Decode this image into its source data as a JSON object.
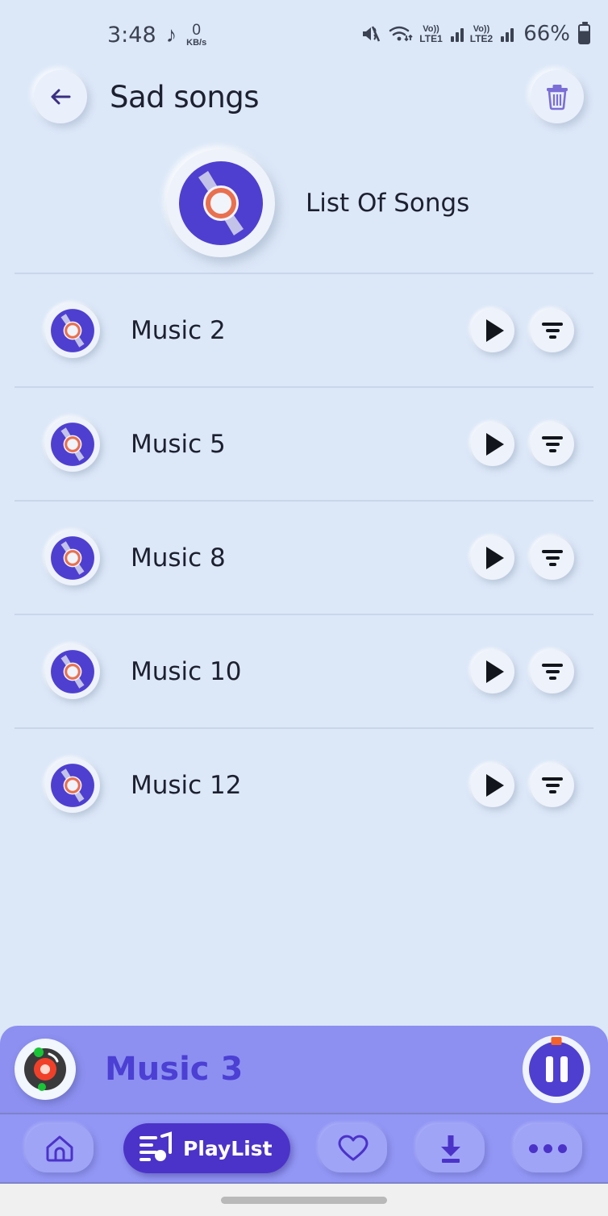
{
  "status_bar": {
    "time": "3:48",
    "music_icon": "music-note-icon",
    "net_speed_value": "0",
    "net_speed_unit": "KB/s",
    "mute_icon": "volume-mute-vibrate-icon",
    "wifi_icon": "wifi-icon",
    "sim1_volte": "Vo))",
    "sim1_label": "LTE1",
    "sim2_volte": "Vo))",
    "sim2_label": "LTE2",
    "battery_percent": "66%",
    "battery_icon": "battery-icon"
  },
  "header": {
    "back_icon": "arrow-left-icon",
    "title": "Sad songs",
    "delete_icon": "trash-icon"
  },
  "list_header": {
    "album_icon": "vinyl-disc-icon",
    "label": "List Of Songs"
  },
  "songs": [
    {
      "title": "Music 2",
      "icon": "vinyl-disc-icon",
      "play_icon": "play-icon",
      "options_icon": "sort-lines-icon"
    },
    {
      "title": "Music 5",
      "icon": "vinyl-disc-icon",
      "play_icon": "play-icon",
      "options_icon": "sort-lines-icon"
    },
    {
      "title": "Music 8",
      "icon": "vinyl-disc-icon",
      "play_icon": "play-icon",
      "options_icon": "sort-lines-icon"
    },
    {
      "title": "Music 10",
      "icon": "vinyl-disc-icon",
      "play_icon": "play-icon",
      "options_icon": "sort-lines-icon"
    },
    {
      "title": "Music 12",
      "icon": "vinyl-disc-icon",
      "play_icon": "play-icon",
      "options_icon": "sort-lines-icon"
    }
  ],
  "mini_player": {
    "artwork_icon": "spinning-vinyl-icon",
    "now_playing_title": "Music 3",
    "transport_icon": "pause-icon",
    "state": "playing"
  },
  "bottom_nav": {
    "items": [
      {
        "label": "",
        "icon": "home-icon",
        "active": false
      },
      {
        "label": "PlayList",
        "icon": "playlist-icon",
        "active": true
      },
      {
        "label": "",
        "icon": "heart-icon",
        "active": false
      },
      {
        "label": "",
        "icon": "download-icon",
        "active": false
      },
      {
        "label": "",
        "icon": "more-dots-icon",
        "active": false
      }
    ]
  },
  "colors": {
    "background": "#dce8f8",
    "accent_purple": "#4b33c9",
    "disc_purple": "#4f3fd0",
    "mini_player_bg": "#8d90f0",
    "nav_bg": "#9296f4",
    "center_orange": "#e8704f",
    "text_dark": "#1d2030"
  }
}
